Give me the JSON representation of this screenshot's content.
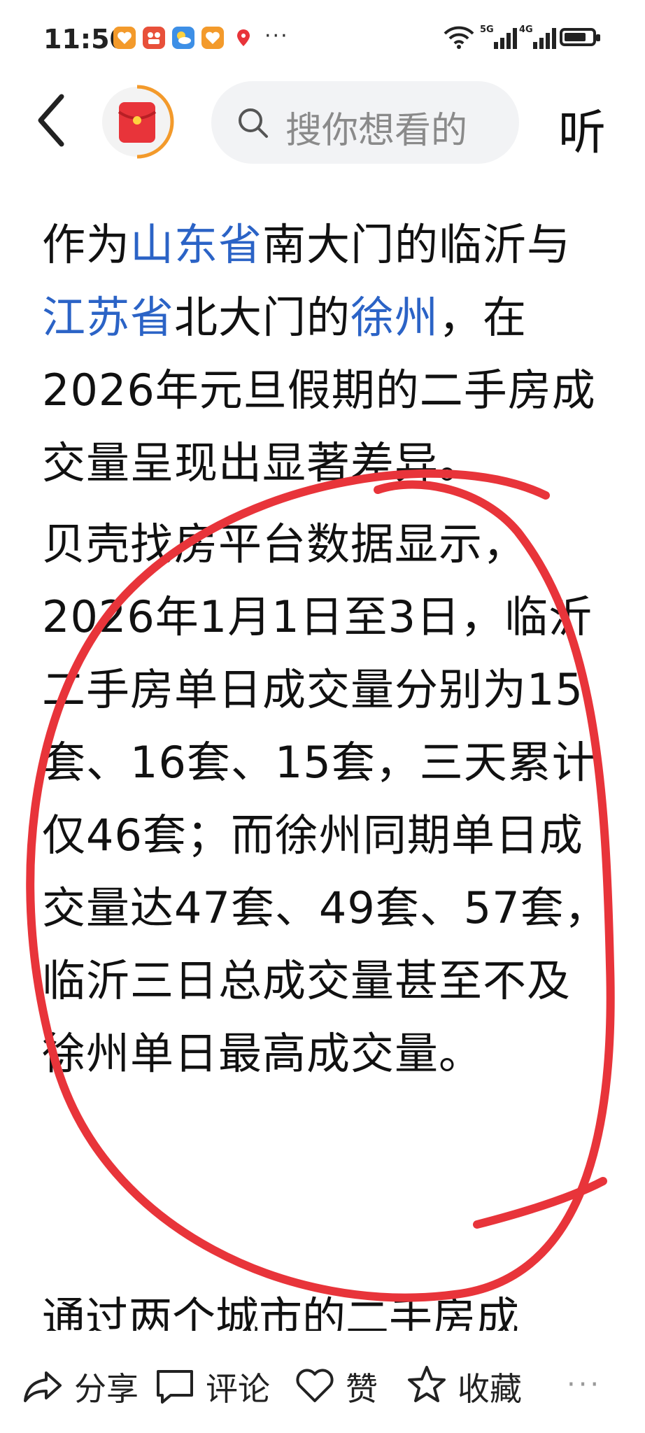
{
  "status_bar": {
    "time": "11:50",
    "more_indicator": "···",
    "network_5g": "5G",
    "network_4g": "4G",
    "notification_icons": [
      "heart-app-icon",
      "video-app-icon",
      "weather-icon",
      "heart-app-icon",
      "du-map-icon"
    ],
    "battery_percent": 80
  },
  "top_bar": {
    "search_placeholder": "搜你想看的",
    "listen_label": "听",
    "icons": {
      "back": "back-chevron-icon",
      "avatar": "red-envelope-icon",
      "search": "search-icon"
    }
  },
  "article": {
    "p1": {
      "t1": "作为",
      "l1": "山东省",
      "t2": "南大门的临沂与",
      "l2": "江苏省",
      "t3": "北大门的",
      "l3": "徐州",
      "t4": "，在2026年元旦假期的二手房成交量呈现出显著差异。"
    },
    "p2": "贝壳找房平台数据显示，2026年1月1日至3日，临沂二手房单日成交量分别为15套、16套、15套，三天累计仅46套；而徐州同期单日成交量达47套、49套、57套，临沂三日总成交量甚至不及徐州单日最高成交量。",
    "p3_partial": "通过两个城市的二手房成"
  },
  "colors": {
    "link": "#2b63c6",
    "annotation_circle": "#e8343a",
    "search_bg": "#f2f3f5",
    "avatar_red": "#e8343a"
  },
  "bottom_bar": {
    "share_label": "分享",
    "comment_label": "评论",
    "like_label": "赞",
    "favorite_label": "收藏",
    "more_label": "···"
  }
}
